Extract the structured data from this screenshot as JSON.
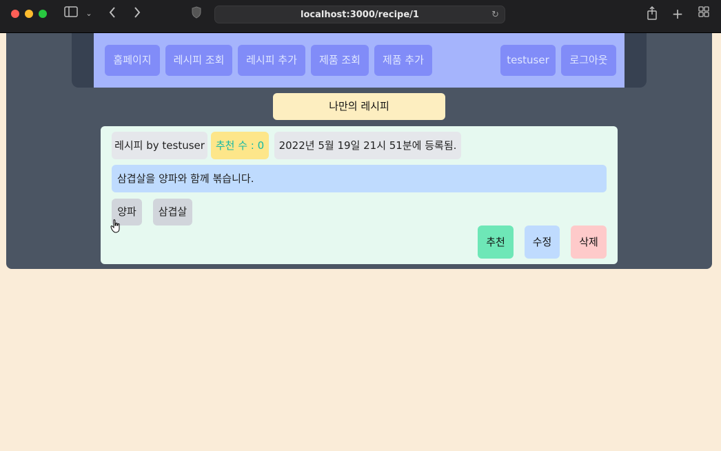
{
  "browser": {
    "url": "localhost:3000/recipe/1"
  },
  "nav": {
    "left": [
      "홈페이지",
      "레시피 조회",
      "레시피 추가",
      "제품 조회",
      "제품 추가"
    ],
    "user": "testuser",
    "logout": "로그아웃"
  },
  "page_title": "나만의 레시피",
  "recipe": {
    "author_label": "레시피 by testuser",
    "recommend_count": "추천 수 : 0",
    "registered": "2022년 5월 19일 21시 51분에 등록됨.",
    "description": "삼겹살을 양파와 함께 볶습니다.",
    "tags": [
      "양파",
      "삼겹살"
    ]
  },
  "actions": {
    "recommend": "추천",
    "edit": "수정",
    "delete": "삭제"
  }
}
